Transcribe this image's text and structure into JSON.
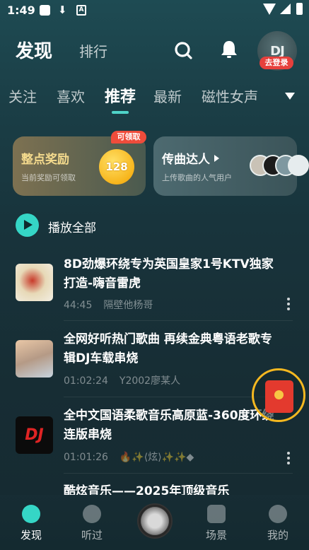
{
  "status_bar": {
    "time": "1:49"
  },
  "header": {
    "title": "发现",
    "secondary": "排行",
    "avatar_text": "DJ",
    "login_badge": "去登录"
  },
  "tabs": {
    "items": [
      "关注",
      "喜欢",
      "推荐",
      "最新",
      "磁性女声"
    ],
    "active": "推荐"
  },
  "cards": {
    "reward": {
      "title": "整点奖励",
      "subtitle": "当前奖励可领取",
      "coin": "128",
      "badge": "可领取"
    },
    "expert": {
      "title": "传曲达人",
      "subtitle": "上传歌曲的人气用户"
    }
  },
  "play_all": {
    "label": "播放全部"
  },
  "songs": [
    {
      "title": "8D劲爆环绕专为英国皇家1号KTV独家打造-嗨音雷虎",
      "duration": "44:45",
      "uploader": "隔壁他杨哥"
    },
    {
      "title": "全网好听热门歌曲 再续金典粤语老歌专辑DJ车载串烧",
      "duration": "01:02:24",
      "uploader": "Y2002廖某人"
    },
    {
      "title": "全中文国语柔歌音乐高原蓝-360度环绕连版串烧",
      "duration": "01:01:26",
      "uploader": "🔥✨⟨炫⟩✨✨◆"
    },
    {
      "title": "酷炫音乐——2025年顶级音乐",
      "duration": "",
      "uploader": ""
    }
  ],
  "bottom_nav": {
    "items": [
      "发现",
      "听过",
      "场景",
      "我的"
    ],
    "active": "发现"
  },
  "colors": {
    "accent": "#35d6c6",
    "badge_red": "#e6403c",
    "reward_gold": "#f6dc8e"
  }
}
